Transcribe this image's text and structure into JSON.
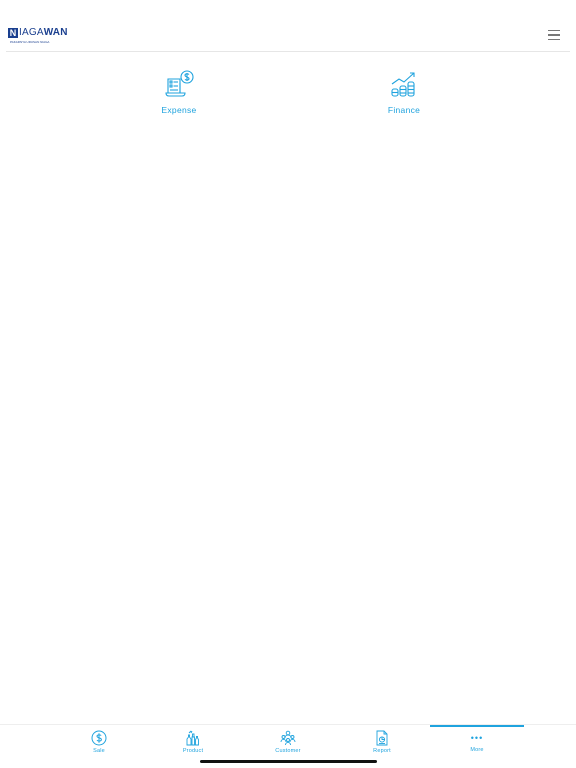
{
  "brand": {
    "logo_letter": "N",
    "logo_middle": "IAGA",
    "logo_end": "WAN",
    "tagline": "PAKARNYA URUSAN NIAGA"
  },
  "header": {
    "menu_icon": "hamburger-menu-icon"
  },
  "tiles": [
    {
      "label": "Expense",
      "icon": "expense-receipt-icon"
    },
    {
      "label": "Finance",
      "icon": "finance-growth-icon"
    }
  ],
  "tabbar": {
    "active": "More",
    "items": [
      {
        "label": "Sale",
        "icon": "dollar-circle-icon"
      },
      {
        "label": "Product",
        "icon": "product-bottles-icon"
      },
      {
        "label": "Customer",
        "icon": "customers-group-icon"
      },
      {
        "label": "Report",
        "icon": "report-document-icon"
      },
      {
        "label": "More",
        "icon": "more-dots-icon"
      }
    ]
  },
  "colors": {
    "accent": "#1fa3de",
    "brand": "#1a3f8f"
  }
}
